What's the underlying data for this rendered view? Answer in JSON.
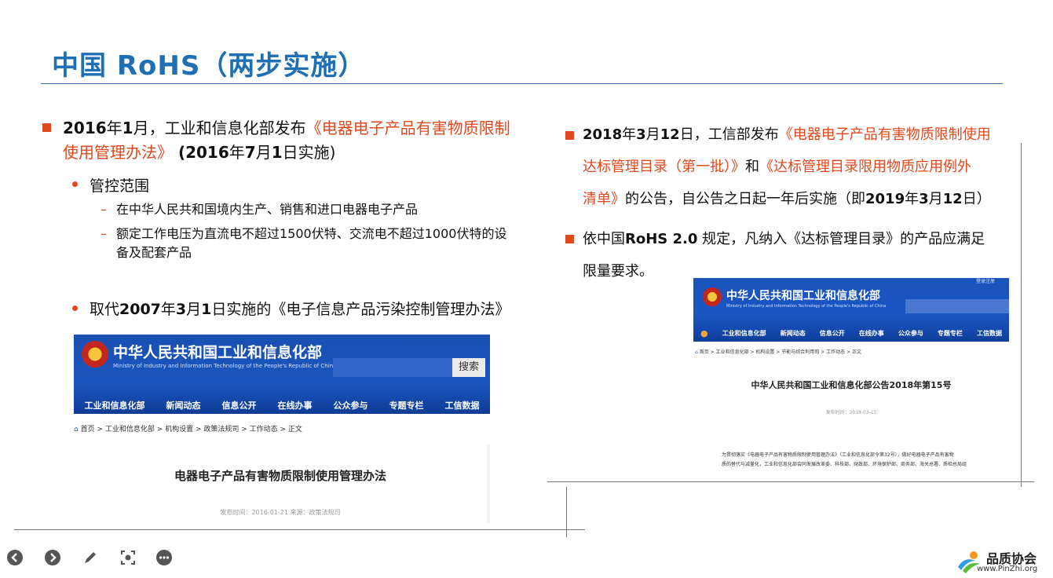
{
  "slide": {
    "title": "中国 RoHS（两步实施）"
  },
  "left": {
    "item1_line1_prefix_bold_year": "2016",
    "item1_line1_year_char": "年",
    "item1_line1_month": "1",
    "item1_line1_mid": "月，工业和信息化部发布",
    "item1_line1_orange": "《电器电子产品有害物质限制",
    "item1_line2_orange": "使用管理办法》",
    "item1_line2_rest_a": " (2016",
    "item1_line2_rest_b": "年",
    "item1_line2_rest_c": "7",
    "item1_line2_rest_d": "月",
    "item1_line2_rest_e": "1",
    "item1_line2_rest_f": "日实施)",
    "scope_label": "管控范围",
    "scope_item1": "在中华人民共和国境内生产、销售和进口电器电子产品",
    "scope_item2_line1": "额定工作电压为直流电不超过1500伏特、交流电不超过1000伏特的设",
    "scope_item2_line2": "备及配套产品",
    "replace_prefix": "取代",
    "replace_year": "2007",
    "replace_mid1": "年",
    "replace_month": "3",
    "replace_mid2": "月",
    "replace_day": "1",
    "replace_rest": "日实施的《电子信息产品污染控制管理办法》"
  },
  "right": {
    "p1_a": "2018",
    "p1_b": "年",
    "p1_c": "3",
    "p1_d": "月",
    "p1_e": "12",
    "p1_f": "日，工信部发布",
    "p1_orange1": "《电器电子产品有害物质限制使用",
    "p1_orange2": "达标管理目录（第一批）》",
    "p1_and": "和",
    "p1_orange3": "《达标管理目录限用物质应用例外",
    "p1_orange4": "清单》",
    "p1_tail_a": "的公告，自公告之日起一年后实施（即",
    "p1_tail_year": "2019",
    "p1_tail_b": "年",
    "p1_tail_month": "3",
    "p1_tail_c": "月",
    "p1_tail_day": "12",
    "p1_tail_d": "日）",
    "p2_a": "依中国",
    "p2_bold": "RoHS 2.0",
    "p2_b": " 规定，凡纳入《达标管理目录》的产品应满足",
    "p2_line2": "限量要求。"
  },
  "shot1": {
    "ministry": "中华人民共和国工业和信息化部",
    "ministry_en": "Ministry of Industry and Information Technology of the People's Republic of China",
    "search_btn": "搜索",
    "nav": [
      "工业和信息化部",
      "新闻动态",
      "信息公开",
      "在线办事",
      "公众参与",
      "专题专栏",
      "工信数据"
    ],
    "breadcrumb": "首页 > 工业和信息化部 > 机构设置 > 政策法规司 > 工作动态 > 正文",
    "headline": "电器电子产品有害物质限制使用管理办法",
    "meta": "发布时间：2016-01-21  来源：政策法规司"
  },
  "shot2": {
    "ministry": "中华人民共和国工业和信息化部",
    "ministry_en": "Ministry of Industry and Information Technology of the People's Republic of China",
    "login": "登录注册",
    "nav": [
      "工业和信息化部",
      "新闻动态",
      "信息公开",
      "在线办事",
      "公众参与",
      "专题专栏",
      "工信数据"
    ],
    "breadcrumb": "首页 > 工业和信息化部 > 机构设置 > 节能与综合利用司 > 工作动态 > 正文",
    "headline": "中华人民共和国工业和信息化部公告2018年第15号",
    "meta": "发布时间：2018-03-15",
    "body1": "为贯彻落实《电器电子产品有害物质限制使用管理办法》（工业和信息化部令第32号），做好电器电子产品有害物",
    "body2": "质的替代与减量化，工业和信息化部会同发展改革委、科技部、财政部、环境保护部、商务部、海关总署、质检总局组"
  },
  "logo": {
    "cn": "品质协会",
    "url": "www.PinZhi.org"
  },
  "colors": {
    "title": "#1f6fb5",
    "accent": "#e0481e",
    "banner": "#1a55c2"
  }
}
